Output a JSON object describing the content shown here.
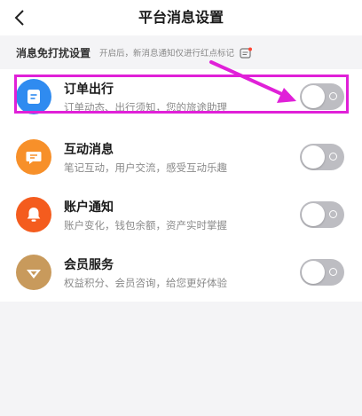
{
  "header": {
    "title": "平台消息设置"
  },
  "section": {
    "title": "消息免打扰设置",
    "hint": "开启后，新消息通知仅进行红点标记"
  },
  "items": [
    {
      "title": "订单出行",
      "desc": "订单动态、出行须知，您的旅途助理",
      "icon": "document-icon",
      "color": "#2f8bf0",
      "enabled": false
    },
    {
      "title": "互动消息",
      "desc": "笔记互动，用户交流，感受互动乐趣",
      "icon": "chat-bubble-icon",
      "color": "#f7902a",
      "enabled": false
    },
    {
      "title": "账户通知",
      "desc": "账户变化，钱包余额，资产实时掌握",
      "icon": "bell-icon",
      "color": "#f45c1e",
      "enabled": false
    },
    {
      "title": "会员服务",
      "desc": "权益积分、会员咨询，给您更好体验",
      "icon": "diamond-icon",
      "color": "#c89a5c",
      "enabled": false
    }
  ],
  "annotation": {
    "color": "#e020d8"
  }
}
